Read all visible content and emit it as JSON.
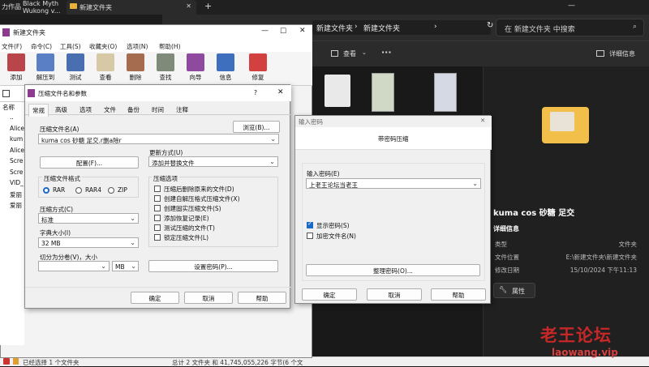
{
  "top_left_text": "力作品",
  "top_window_title_line1": "Black Myth",
  "top_window_title_line2": "Wukong v...",
  "explorer": {
    "tab_label": "新建文件夹",
    "new_tab": "+",
    "breadcrumb": [
      "新建文件夹",
      "新建文件夹"
    ],
    "search_placeholder": "在 新建文件夹 中搜索",
    "toolbar": {
      "view": "查看",
      "more": "···",
      "details": "详细信息"
    },
    "details": {
      "name": "kuma cos 砂糖 足交",
      "header": "详细信息",
      "rows": [
        {
          "k": "类型",
          "v": "文件夹"
        },
        {
          "k": "文件位置",
          "v": "E:\\新建文件夹\\新建文件夹"
        },
        {
          "k": "修改日期",
          "v": "15/10/2024 下午11:13"
        }
      ],
      "properties": "属性"
    },
    "status_left": "已经选择 1 个文件夹",
    "status_mid": "总计 2 文件夹 和 41,745,055,226 字节(6 个文"
  },
  "winrar": {
    "title": "新建文件夹",
    "menu": [
      "文件(F)",
      "命令(C)",
      "工具(S)",
      "收藏夹(O)",
      "选项(N)",
      "帮助(H)"
    ],
    "toolbar": [
      "添加",
      "解压到",
      "测试",
      "查看",
      "删除",
      "查找",
      "向导",
      "信息",
      "修复"
    ],
    "list_header": "名称",
    "files": [
      "..",
      "Alice",
      "kum",
      "Alice",
      "Scre",
      "Scre",
      "VID_",
      "爱丽",
      "爱丽"
    ]
  },
  "archive_dialog": {
    "title": "压缩文件名和参数",
    "help_q": "?",
    "tabs": [
      "常规",
      "高级",
      "选项",
      "文件",
      "备份",
      "时间",
      "注释"
    ],
    "name_label": "压缩文件名(A)",
    "browse": "浏览(B)...",
    "name_value": "kuma cos 砂糖 足交.r删a除r",
    "profile": "配置(F)...",
    "update_label": "更新方式(U)",
    "update_value": "添加并替换文件",
    "format_label": "压缩文件格式",
    "formats": [
      "RAR",
      "RAR4",
      "ZIP"
    ],
    "method_label": "压缩方式(C)",
    "method_value": "标准",
    "dict_label": "字典大小(I)",
    "dict_value": "32 MB",
    "split_label": "切分为分卷(V)，大小",
    "split_unit": "MB",
    "options_label": "压缩选项",
    "options": [
      {
        "label": "压缩后删除原来的文件(D)",
        "checked": false
      },
      {
        "label": "创建自解压格式压缩文件(X)",
        "checked": false
      },
      {
        "label": "创建固实压缩文件(S)",
        "checked": false
      },
      {
        "label": "添加恢复记录(E)",
        "checked": false
      },
      {
        "label": "测试压缩的文件(T)",
        "checked": false
      },
      {
        "label": "锁定压缩文件(L)",
        "checked": false
      }
    ],
    "set_password": "设置密码(P)...",
    "ok": "确定",
    "cancel": "取消",
    "help": "帮助"
  },
  "password_dialog": {
    "title": "输入密码",
    "subtitle": "带密码压缩",
    "enter_label": "输入密码(E)",
    "value": "上老王论坛当老王",
    "show_password": "显示密码(S)",
    "encrypt_names": "加密文件名(N)",
    "organize": "整理密码(O)...",
    "ok": "确定",
    "cancel": "取消",
    "help": "帮助"
  },
  "watermark": {
    "cn": "老王论坛",
    "url": "laowang.vip"
  }
}
